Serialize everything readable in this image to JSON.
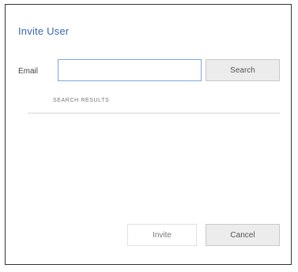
{
  "dialog": {
    "title": "Invite User",
    "email_label": "Email",
    "email_value": "",
    "email_placeholder": "",
    "search_label": "Search",
    "results_label": "SEARCH RESULTS",
    "invite_label": "Invite",
    "cancel_label": "Cancel"
  }
}
